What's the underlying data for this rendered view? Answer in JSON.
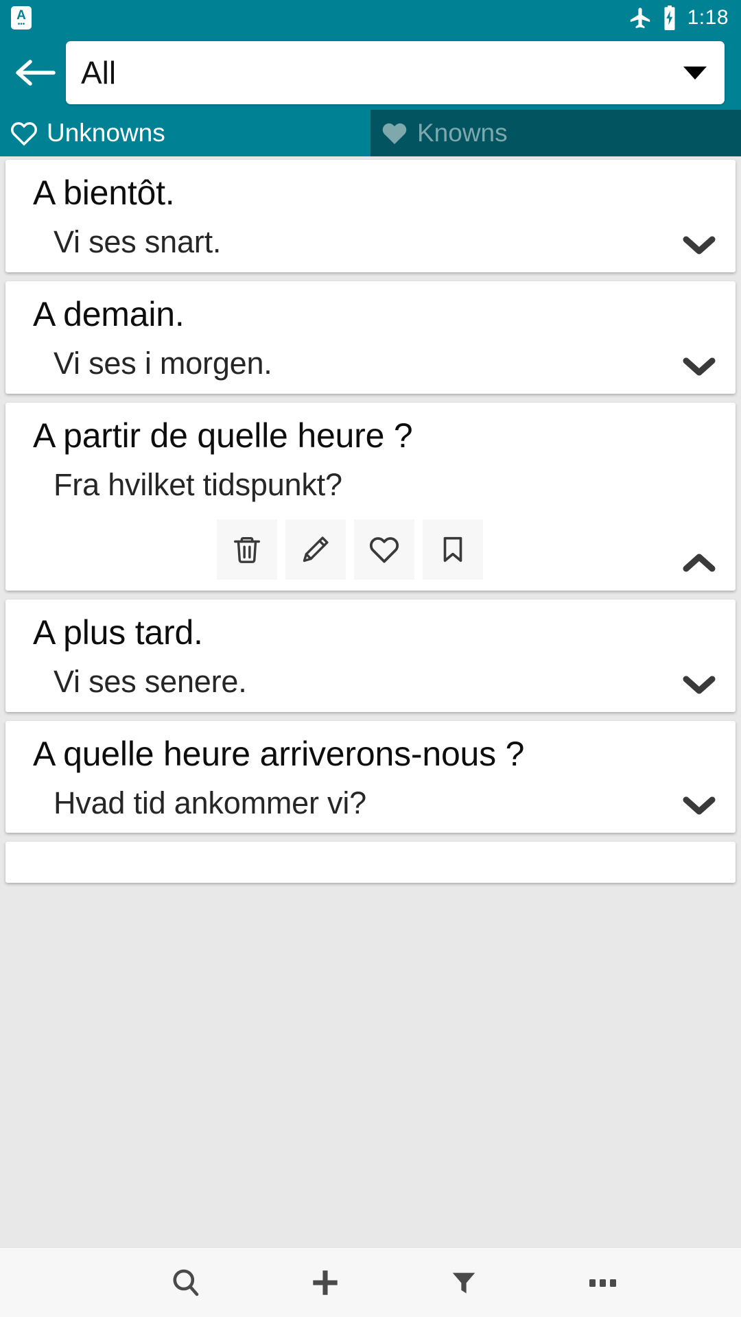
{
  "status_bar": {
    "notification_icon": "app-notification-icon",
    "notification_letter": "A",
    "notification_dots": "•••",
    "airplane_icon": "airplane-mode-icon",
    "battery_icon": "battery-charging-icon",
    "time": "1:18"
  },
  "toolbar": {
    "back_icon": "back-arrow-icon",
    "spinner_value": "All",
    "spinner_caret_icon": "dropdown-caret-icon"
  },
  "tabs": [
    {
      "label": "Unknowns",
      "icon": "heart-outline-icon",
      "active": true
    },
    {
      "label": "Knowns",
      "icon": "heart-filled-icon",
      "active": false
    }
  ],
  "cards": [
    {
      "term": "A bientôt.",
      "translation": "Vi ses snart.",
      "expanded": false,
      "chevron_icon": "chevron-down-icon"
    },
    {
      "term": "A demain.",
      "translation": "Vi ses i morgen.",
      "expanded": false,
      "chevron_icon": "chevron-down-icon"
    },
    {
      "term": "A partir de quelle heure ?",
      "translation": "Fra hvilket tidspunkt?",
      "expanded": true,
      "chevron_icon": "chevron-up-icon",
      "actions": [
        {
          "name": "delete-button",
          "icon": "trash-icon"
        },
        {
          "name": "edit-button",
          "icon": "pencil-icon"
        },
        {
          "name": "favorite-button",
          "icon": "heart-outline-icon"
        },
        {
          "name": "bookmark-button",
          "icon": "bookmark-icon"
        }
      ]
    },
    {
      "term": "A plus tard.",
      "translation": "Vi ses senere.",
      "expanded": false,
      "chevron_icon": "chevron-down-icon"
    },
    {
      "term": "A quelle heure arriverons-nous ?",
      "translation": "Hvad tid ankommer vi?",
      "expanded": false,
      "chevron_icon": "chevron-down-icon"
    }
  ],
  "bottom_bar": [
    {
      "name": "search-button",
      "icon": "search-icon"
    },
    {
      "name": "add-button",
      "icon": "plus-icon"
    },
    {
      "name": "filter-button",
      "icon": "filter-icon"
    },
    {
      "name": "overflow-button",
      "icon": "more-horizontal-icon"
    }
  ],
  "colors": {
    "primary_teal": "#008294",
    "tab_inactive": "#025560",
    "tab_inactive_text": "#7fa8ad",
    "page_background": "#e8e8e8",
    "card_background": "#ffffff",
    "icon_dark": "#3a3a3a"
  }
}
